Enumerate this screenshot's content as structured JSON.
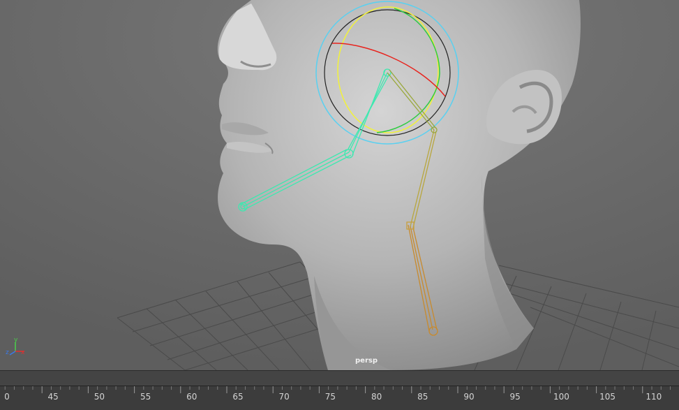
{
  "viewport": {
    "camera_name": "persp",
    "axis_label_y": "y",
    "axis_label_z": "z",
    "axis_label_x": "x"
  },
  "timeline": {
    "ticks": [
      "0",
      "45",
      "50",
      "55",
      "60",
      "65",
      "70",
      "75",
      "80",
      "85",
      "90",
      "95",
      "100",
      "105",
      "110"
    ]
  },
  "colors": {
    "viewport_bg": "#6e6e6e",
    "jaw_joint": "#3ee8b0",
    "rotate_y_ring": "#f2f23a",
    "rotate_z_ring": "#2ecc40",
    "rotate_x_ring": "#e8221c",
    "outer_ring": "#5ad0f0",
    "neck_joint": "#c88a2c",
    "head_joint": "#9aa83c"
  }
}
